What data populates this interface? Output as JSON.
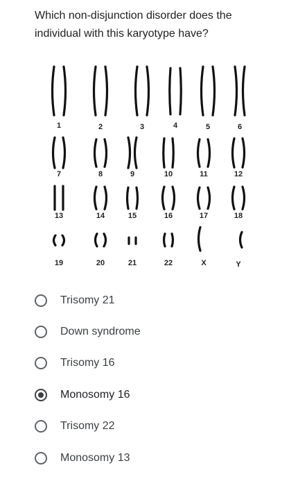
{
  "question": {
    "text": "Which non-disjunction disorder does the individual with this karyotype have?"
  },
  "karyotype": {
    "rows": [
      {
        "labels": [
          "1",
          "2",
          "3",
          "4",
          "5",
          "6"
        ]
      },
      {
        "labels": [
          "7",
          "8",
          "9",
          "10",
          "11",
          "12"
        ]
      },
      {
        "labels": [
          "13",
          "14",
          "15",
          "16",
          "17",
          "18"
        ]
      },
      {
        "labels": [
          "19",
          "20",
          "21",
          "22",
          "X",
          "Y"
        ]
      }
    ]
  },
  "options": [
    {
      "label": "Trisomy 21",
      "selected": false
    },
    {
      "label": "Down syndrome",
      "selected": false
    },
    {
      "label": "Trisomy 16",
      "selected": false
    },
    {
      "label": "Monosomy 16",
      "selected": true
    },
    {
      "label": "Trisomy 22",
      "selected": false
    },
    {
      "label": "Monosomy 13",
      "selected": false
    }
  ]
}
